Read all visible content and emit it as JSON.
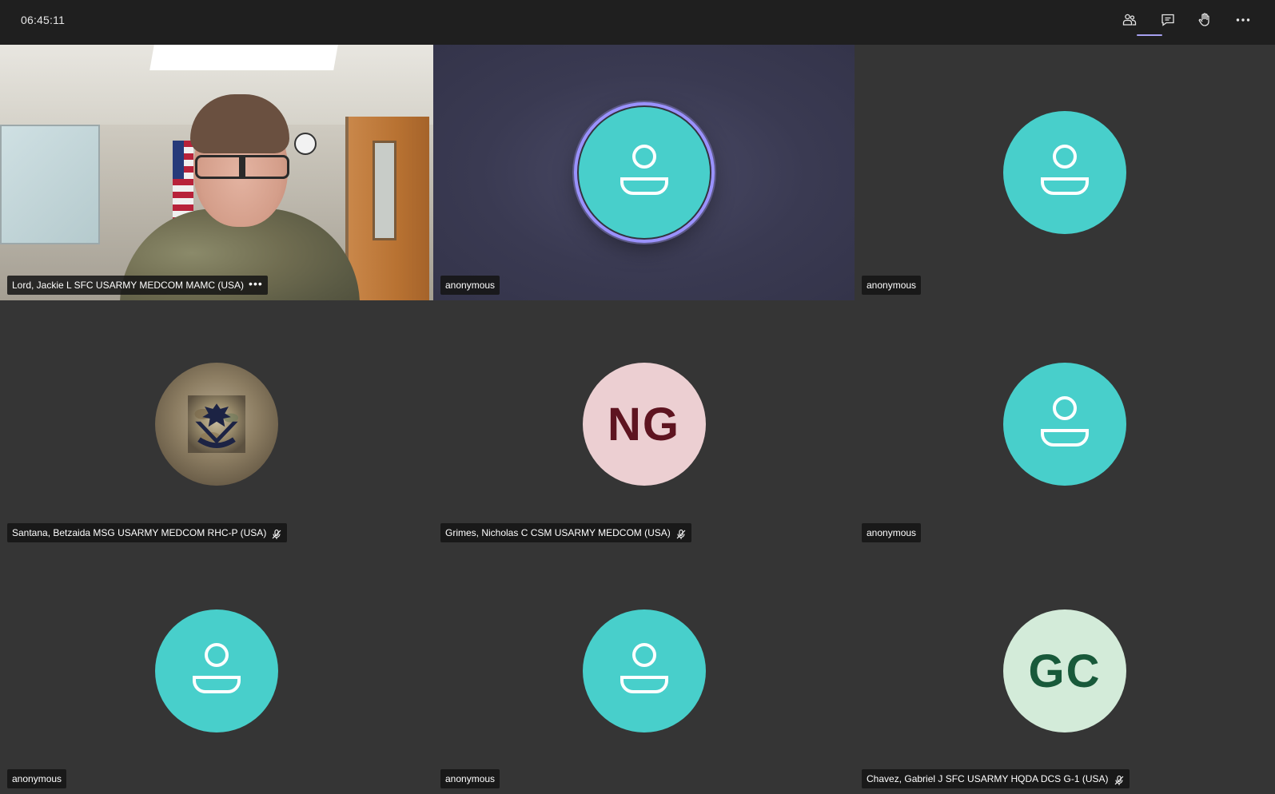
{
  "meeting": {
    "clock": "06:45:11"
  },
  "toolbar": {
    "participants": "participants-icon",
    "chat": "chat-icon",
    "raise_hand": "raise-hand-icon",
    "more": "more-icon",
    "active_accent": "#a7a0f0"
  },
  "tiles": [
    {
      "name": "Lord, Jackie L SFC USARMY MEDCOM MAMC (USA)",
      "type": "video",
      "more_glyph": "•••"
    },
    {
      "name": "anonymous",
      "type": "avatar",
      "speaking": true
    },
    {
      "name": "anonymous",
      "type": "avatar"
    },
    {
      "name": "Santana, Betzaida MSG USARMY MEDCOM RHC-P (USA)",
      "type": "photo",
      "muted": true
    },
    {
      "name": "Grimes, Nicholas C CSM USARMY MEDCOM (USA)",
      "type": "initials",
      "initials": "NG",
      "muted": true
    },
    {
      "name": "anonymous",
      "type": "avatar"
    },
    {
      "name": "anonymous",
      "type": "avatar"
    },
    {
      "name": "anonymous",
      "type": "avatar"
    },
    {
      "name": "Chavez, Gabriel J SFC USARMY HQDA DCS G-1 (USA)",
      "type": "initials",
      "initials": "GC",
      "muted": true
    }
  ],
  "colors": {
    "avatar_teal": "#48cfcb",
    "speaking_ring": "#9a92ff",
    "ng_bg": "#eccfd2",
    "ng_fg": "#5e1420",
    "gc_bg": "#d3ebd9",
    "gc_fg": "#18593a",
    "tile_bg": "#353535",
    "topbar_bg": "#1f1f1f"
  }
}
